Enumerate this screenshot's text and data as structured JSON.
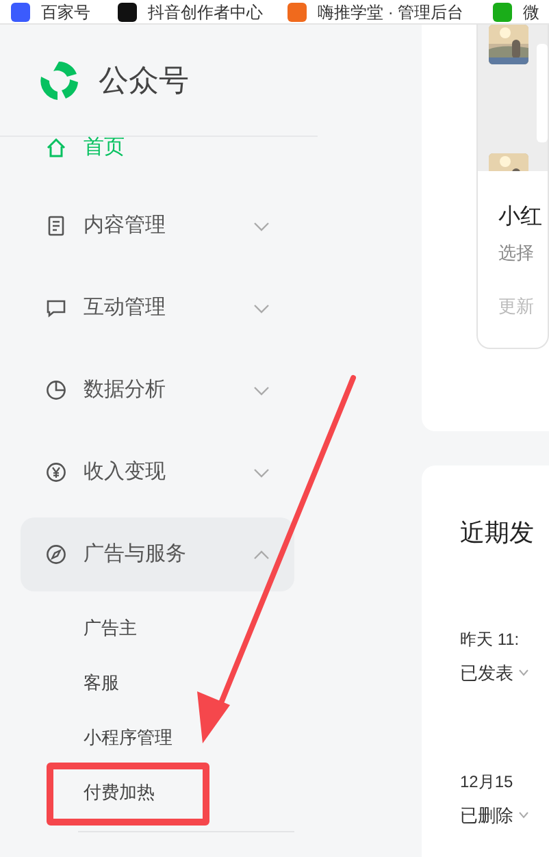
{
  "bookmarks": [
    {
      "label": "百家号",
      "color": "#3b5bfd"
    },
    {
      "label": "抖音创作者中心",
      "color": "#111111"
    },
    {
      "label": "嗨推学堂 · 管理后台",
      "color": "#f06a1d"
    },
    {
      "label": "微",
      "color": "#1aad19"
    }
  ],
  "sidebar": {
    "brand": "公众号",
    "items": [
      {
        "label": "首页",
        "kind": "home",
        "selected": true
      },
      {
        "label": "内容管理",
        "kind": "document",
        "selected": false,
        "expanded": false
      },
      {
        "label": "互动管理",
        "kind": "chat",
        "selected": false,
        "expanded": false
      },
      {
        "label": "数据分析",
        "kind": "pie",
        "selected": false,
        "expanded": false
      },
      {
        "label": "收入变现",
        "kind": "yen",
        "selected": false,
        "expanded": false
      },
      {
        "label": "广告与服务",
        "kind": "compass",
        "selected": false,
        "expanded": true,
        "children": [
          {
            "label": "广告主",
            "highlighted": false
          },
          {
            "label": "客服",
            "highlighted": false
          },
          {
            "label": "小程序管理",
            "highlighted": false
          },
          {
            "label": "付费加热",
            "highlighted": true
          }
        ]
      }
    ]
  },
  "preview_card": {
    "title": "小红",
    "description": "选择",
    "updated": "更新"
  },
  "recent_posts": {
    "title": "近期发",
    "posts": [
      {
        "time": "昨天 11:",
        "status": "已发表"
      },
      {
        "time": "12月15",
        "status": "已删除"
      }
    ]
  },
  "annotations": [
    {
      "kind": "arrow"
    }
  ]
}
